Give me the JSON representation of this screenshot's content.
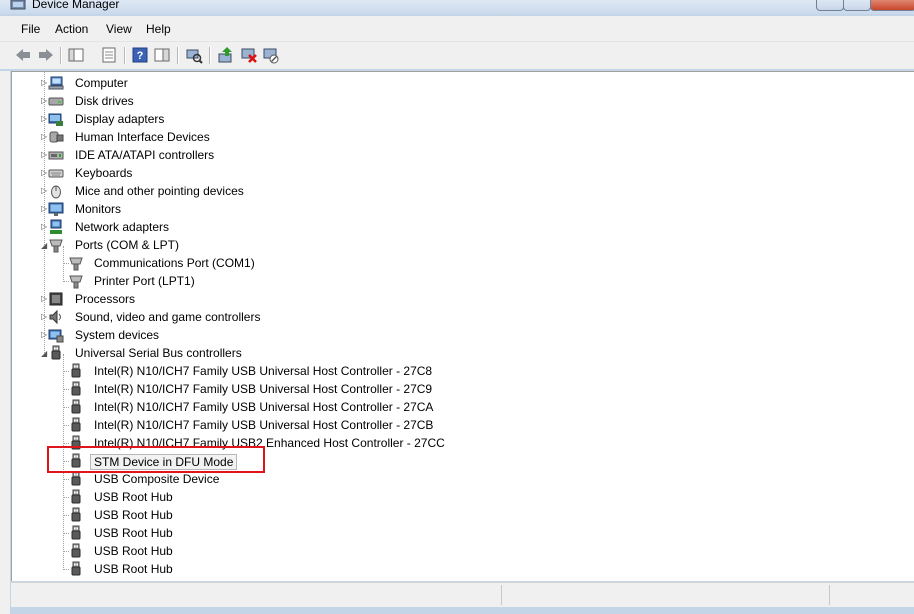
{
  "window": {
    "title": "Device Manager"
  },
  "menu": [
    "File",
    "Action",
    "View",
    "Help"
  ],
  "toolbar": [
    "back-icon",
    "forward-icon",
    "show-hide-console-tree-icon",
    "properties-icon",
    "help-icon",
    "action-pane-icon",
    "scan-hardware-icon",
    "update-driver-icon",
    "uninstall-icon",
    "disable-icon"
  ],
  "tree": {
    "categories": [
      {
        "label": "Computer",
        "icon": "computer-icon",
        "expanded": false
      },
      {
        "label": "Disk drives",
        "icon": "disk-drive-icon",
        "expanded": false
      },
      {
        "label": "Display adapters",
        "icon": "display-adapter-icon",
        "expanded": false
      },
      {
        "label": "Human Interface Devices",
        "icon": "hid-icon",
        "expanded": false
      },
      {
        "label": "IDE ATA/ATAPI controllers",
        "icon": "ide-controller-icon",
        "expanded": false
      },
      {
        "label": "Keyboards",
        "icon": "keyboard-icon",
        "expanded": false
      },
      {
        "label": "Mice and other pointing devices",
        "icon": "mouse-icon",
        "expanded": false
      },
      {
        "label": "Monitors",
        "icon": "monitor-icon",
        "expanded": false
      },
      {
        "label": "Network adapters",
        "icon": "network-adapter-icon",
        "expanded": false
      },
      {
        "label": "Ports (COM & LPT)",
        "icon": "port-icon",
        "expanded": true,
        "children": [
          "Communications Port (COM1)",
          "Printer Port (LPT1)"
        ]
      },
      {
        "label": "Processors",
        "icon": "processor-icon",
        "expanded": false
      },
      {
        "label": "Sound, video and game controllers",
        "icon": "sound-icon",
        "expanded": false
      },
      {
        "label": "System devices",
        "icon": "system-devices-icon",
        "expanded": false
      },
      {
        "label": "Universal Serial Bus controllers",
        "icon": "usb-icon",
        "expanded": true,
        "children": [
          "Intel(R) N10/ICH7 Family USB Universal Host Controller - 27C8",
          "Intel(R) N10/ICH7 Family USB Universal Host Controller - 27C9",
          "Intel(R) N10/ICH7 Family USB Universal Host Controller - 27CA",
          "Intel(R) N10/ICH7 Family USB Universal Host Controller - 27CB",
          "Intel(R) N10/ICH7 Family USB2 Enhanced Host Controller - 27CC",
          "STM Device in DFU Mode",
          "USB Composite Device",
          "USB Root Hub",
          "USB Root Hub",
          "USB Root Hub",
          "USB Root Hub",
          "USB Root Hub"
        ]
      }
    ],
    "selected": "STM Device in DFU Mode"
  },
  "colors": {
    "highlight": "#e0141b",
    "selection_bg": "#f2f2f2"
  }
}
